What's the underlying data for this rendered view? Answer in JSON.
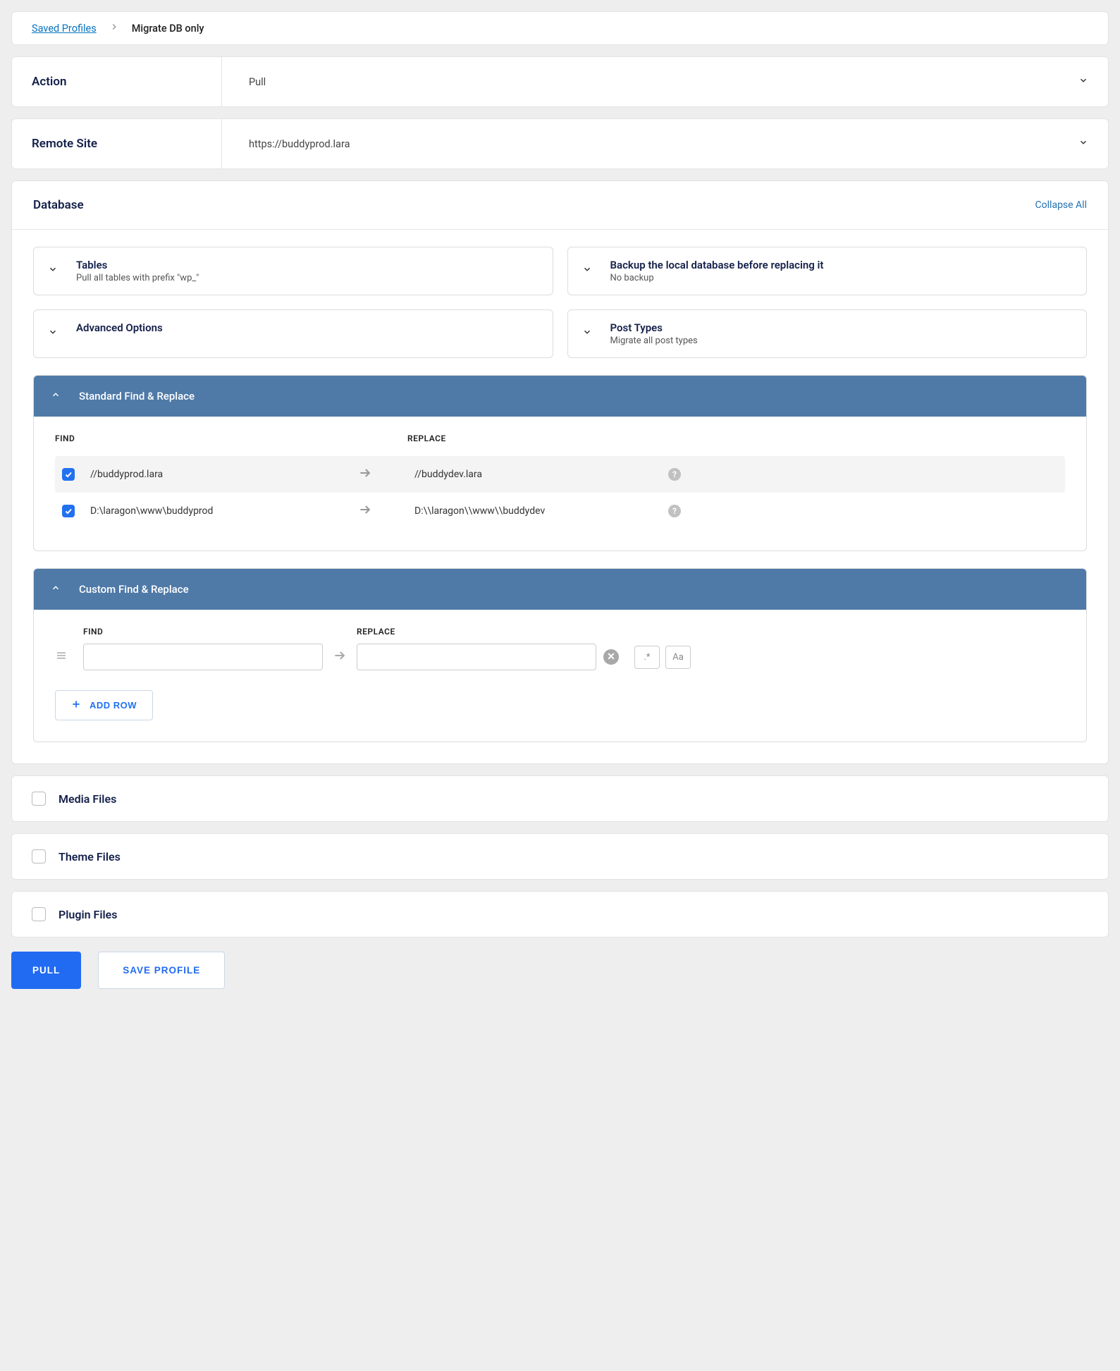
{
  "breadcrumb": {
    "link": "Saved Profiles",
    "current": "Migrate DB only"
  },
  "action_row": {
    "label": "Action",
    "value": "Pull"
  },
  "remote_row": {
    "label": "Remote Site",
    "value": "https://buddyprod.lara"
  },
  "database": {
    "title": "Database",
    "collapse": "Collapse All",
    "panels": {
      "tables": {
        "title": "Tables",
        "subtitle": "Pull all tables with prefix \"wp_\""
      },
      "backup": {
        "title": "Backup the local database before replacing it",
        "subtitle": "No backup"
      },
      "advanced": {
        "title": "Advanced Options"
      },
      "post_types": {
        "title": "Post Types",
        "subtitle": "Migrate all post types"
      }
    },
    "standard_fr": {
      "title": "Standard Find & Replace",
      "find_label": "FIND",
      "replace_label": "REPLACE",
      "rows": [
        {
          "find": "//buddyprod.lara",
          "replace": "//buddydev.lara"
        },
        {
          "find": "D:\\laragon\\www\\buddyprod",
          "replace": "D:\\\\laragon\\\\www\\\\buddydev"
        }
      ]
    },
    "custom_fr": {
      "title": "Custom Find & Replace",
      "find_label": "FIND",
      "replace_label": "REPLACE",
      "regex_toggle": ".*",
      "case_toggle": "Aa",
      "add_row": "ADD ROW"
    }
  },
  "file_sections": {
    "media": "Media Files",
    "theme": "Theme Files",
    "plugin": "Plugin Files"
  },
  "buttons": {
    "pull": "PULL",
    "save_profile": "SAVE PROFILE"
  }
}
